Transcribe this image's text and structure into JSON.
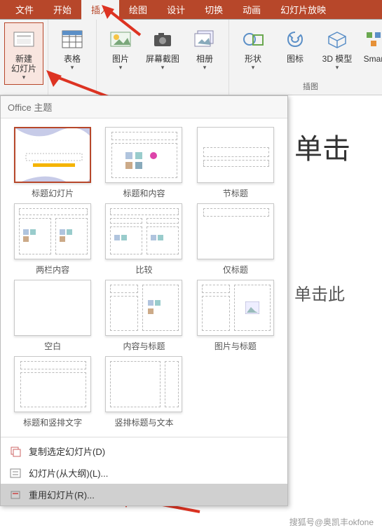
{
  "tabs": {
    "file": "文件",
    "home": "开始",
    "insert": "插入",
    "draw": "绘图",
    "design": "设计",
    "transition": "切换",
    "animation": "动画",
    "slideshow": "幻灯片放映"
  },
  "ribbon": {
    "new_slide": "新建\n幻灯片",
    "table": "表格",
    "picture": "图片",
    "screenshot": "屏幕截图",
    "album": "相册",
    "shape": "形状",
    "icon": "图标",
    "3d_model": "3D 模型",
    "smart": "Smar",
    "group_illustration": "插图"
  },
  "dropdown": {
    "header": "Office 主题",
    "layouts": [
      "标题幻灯片",
      "标题和内容",
      "节标题",
      "两栏内容",
      "比较",
      "仅标题",
      "空白",
      "内容与标题",
      "图片与标题",
      "标题和竖排文字",
      "竖排标题与文本"
    ],
    "menu_duplicate": "复制选定幻灯片(D)",
    "menu_outline": "幻灯片(从大纲)(L)...",
    "menu_reuse": "重用幻灯片(R)..."
  },
  "slide": {
    "title_placeholder": "单击",
    "subtitle_placeholder": "单击此"
  },
  "watermark": "搜狐号@奥凯丰okfone"
}
